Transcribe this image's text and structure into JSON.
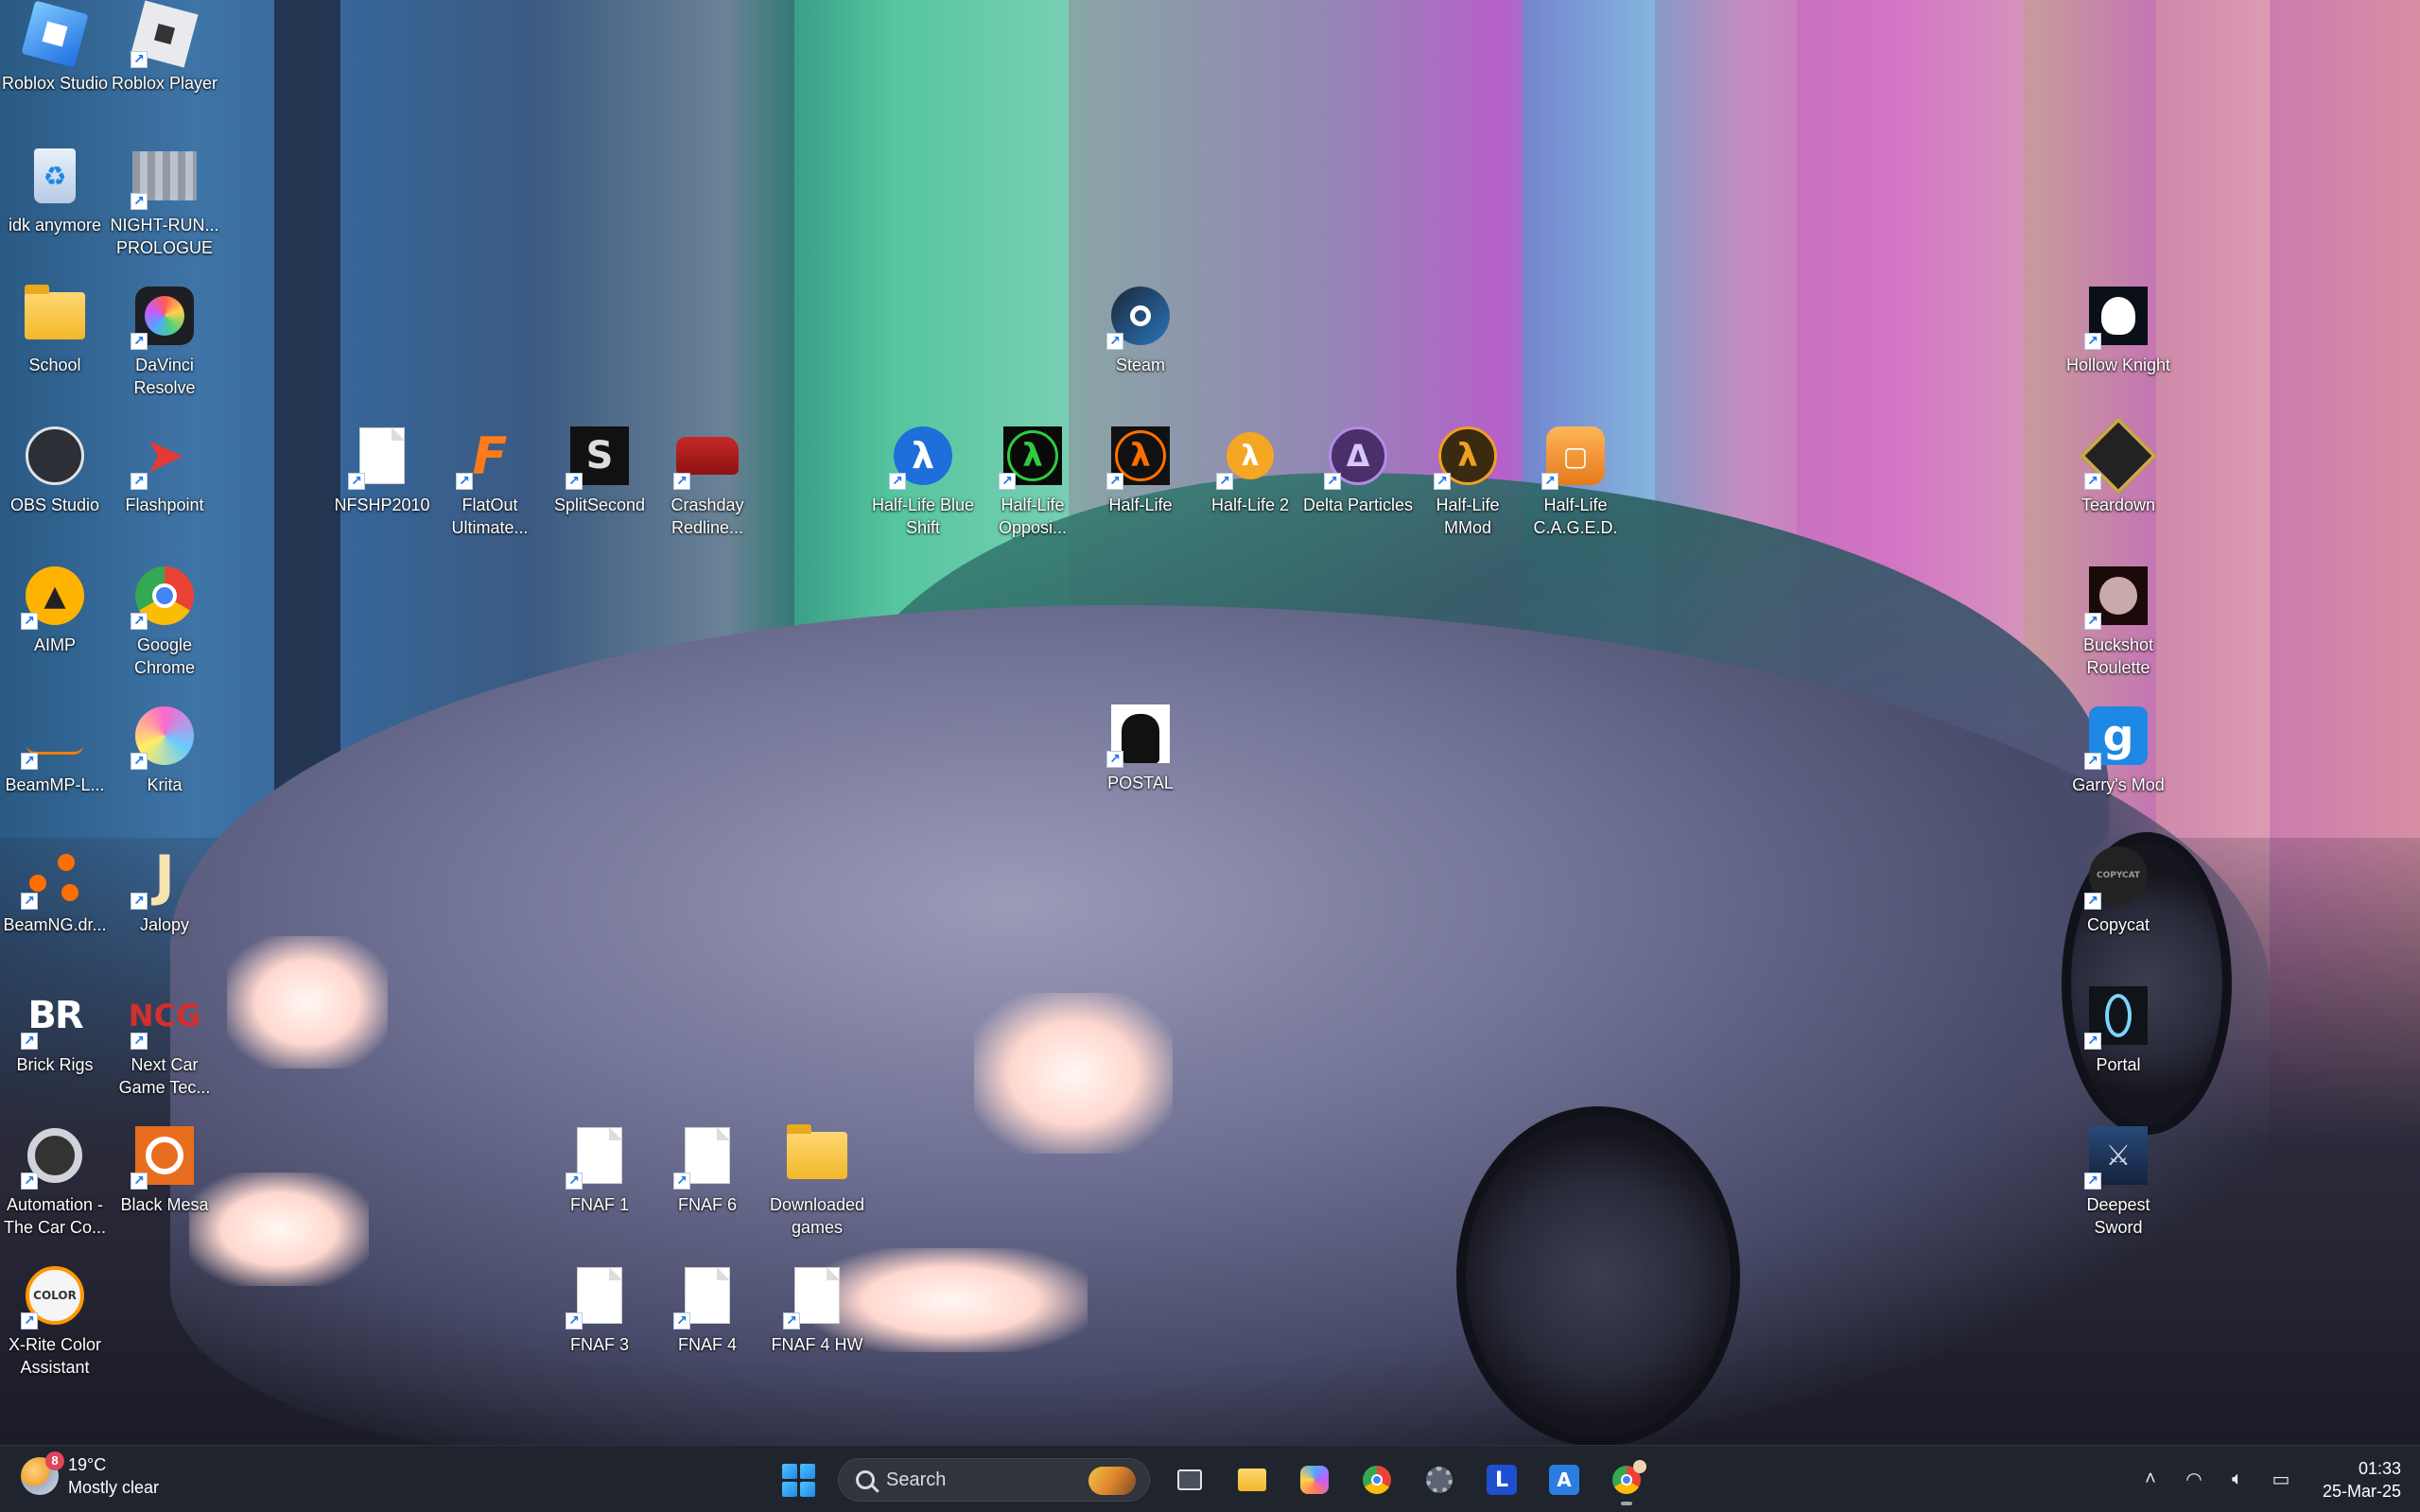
{
  "desktop_icons": [
    {
      "label": "Roblox Studio",
      "icon": "roblox-studio-icon",
      "shortcut": false
    },
    {
      "label": "Roblox Player",
      "icon": "roblox-player-icon",
      "shortcut": true
    },
    {
      "label": "idk anymore",
      "icon": "recycle-bin-icon",
      "shortcut": false
    },
    {
      "label": "NIGHT-RUN... PROLOGUE",
      "icon": "night-run-icon",
      "shortcut": true
    },
    {
      "label": "School",
      "icon": "folder-icon",
      "shortcut": false
    },
    {
      "label": "DaVinci Resolve",
      "icon": "davinci-resolve-icon",
      "shortcut": true
    },
    {
      "label": "OBS Studio",
      "icon": "obs-studio-icon",
      "shortcut": false
    },
    {
      "label": "Flashpoint",
      "icon": "flashpoint-icon",
      "shortcut": true
    },
    {
      "label": "AIMP",
      "icon": "aimp-icon",
      "shortcut": true
    },
    {
      "label": "Google Chrome",
      "icon": "chrome-icon",
      "shortcut": true
    },
    {
      "label": "BeamMP-L...",
      "icon": "beammp-icon",
      "shortcut": true
    },
    {
      "label": "Krita",
      "icon": "krita-icon",
      "shortcut": true
    },
    {
      "label": "BeamNG.dr...",
      "icon": "beamng-icon",
      "shortcut": true
    },
    {
      "label": "Jalopy",
      "icon": "jalopy-icon",
      "shortcut": true
    },
    {
      "label": "Brick Rigs",
      "icon": "brick-rigs-icon",
      "shortcut": true
    },
    {
      "label": "Next Car Game Tec...",
      "icon": "next-car-game-icon",
      "shortcut": true
    },
    {
      "label": "Automation - The Car Co...",
      "icon": "automation-icon",
      "shortcut": true
    },
    {
      "label": "Black Mesa",
      "icon": "black-mesa-icon",
      "shortcut": true
    },
    {
      "label": "X-Rite Color Assistant",
      "icon": "xrite-icon",
      "shortcut": true
    },
    {
      "label": "NFSHP2010",
      "icon": "file-icon",
      "shortcut": true
    },
    {
      "label": "FlatOut Ultimate...",
      "icon": "flatout-icon",
      "shortcut": true
    },
    {
      "label": "SplitSecond",
      "icon": "splitsecond-icon",
      "shortcut": true
    },
    {
      "label": "Crashday Redline...",
      "icon": "crashday-icon",
      "shortcut": true
    },
    {
      "label": "Half-Life Blue Shift",
      "icon": "half-life-blue-shift-icon",
      "shortcut": true
    },
    {
      "label": "Half-Life Opposi...",
      "icon": "half-life-opposing-force-icon",
      "shortcut": true
    },
    {
      "label": "Half-Life",
      "icon": "half-life-icon",
      "shortcut": true
    },
    {
      "label": "Half-Life 2",
      "icon": "half-life-2-icon",
      "shortcut": true
    },
    {
      "label": "Delta Particles",
      "icon": "delta-particles-icon",
      "shortcut": true
    },
    {
      "label": "Half-Life MMod",
      "icon": "half-life-mmod-icon",
      "shortcut": true
    },
    {
      "label": "Half-Life C.A.G.E.D.",
      "icon": "half-life-caged-icon",
      "shortcut": true
    },
    {
      "label": "Steam",
      "icon": "steam-icon",
      "shortcut": true
    },
    {
      "label": "POSTAL",
      "icon": "postal-icon",
      "shortcut": true
    },
    {
      "label": "FNAF 1",
      "icon": "file-icon",
      "shortcut": true
    },
    {
      "label": "FNAF 6",
      "icon": "file-icon",
      "shortcut": true
    },
    {
      "label": "Downloaded games",
      "icon": "folder-icon",
      "shortcut": false
    },
    {
      "label": "FNAF 3",
      "icon": "file-icon",
      "shortcut": true
    },
    {
      "label": "FNAF 4",
      "icon": "file-icon",
      "shortcut": true
    },
    {
      "label": "FNAF 4 HW",
      "icon": "file-icon",
      "shortcut": true
    },
    {
      "label": "Hollow Knight",
      "icon": "hollow-knight-icon",
      "shortcut": true
    },
    {
      "label": "Teardown",
      "icon": "teardown-icon",
      "shortcut": true
    },
    {
      "label": "Buckshot Roulette",
      "icon": "buckshot-roulette-icon",
      "shortcut": true
    },
    {
      "label": "Garry's Mod",
      "icon": "garrys-mod-icon",
      "shortcut": true
    },
    {
      "label": "Copycat",
      "icon": "copycat-icon",
      "shortcut": true
    },
    {
      "label": "Portal",
      "icon": "portal-icon",
      "shortcut": true
    },
    {
      "label": "Deepest Sword",
      "icon": "deepest-sword-icon",
      "shortcut": true
    }
  ],
  "taskbar": {
    "weather": {
      "temp": "19°C",
      "condition": "Mostly clear",
      "badge": "8"
    },
    "search": {
      "placeholder": "Search"
    },
    "apps": [
      {
        "name": "task-view-icon",
        "running": false
      },
      {
        "name": "file-explorer-icon",
        "running": false
      },
      {
        "name": "copilot-icon",
        "running": false
      },
      {
        "name": "chrome-icon",
        "running": false
      },
      {
        "name": "settings-icon",
        "running": false
      },
      {
        "name": "launcher-l-icon",
        "running": false
      },
      {
        "name": "vscode-like-icon",
        "running": false
      },
      {
        "name": "chrome-profile-icon",
        "running": true
      }
    ],
    "clock": {
      "time": "01:33",
      "date": "25-Mar-25"
    }
  }
}
